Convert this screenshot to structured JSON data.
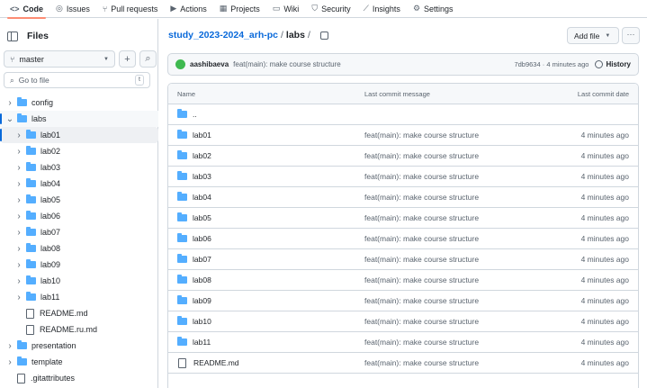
{
  "topnav": {
    "items": [
      {
        "icon": "<>",
        "label": "Code",
        "active": true
      },
      {
        "icon": "◎",
        "label": "Issues"
      },
      {
        "icon": "⑂",
        "label": "Pull requests"
      },
      {
        "icon": "▶",
        "label": "Actions"
      },
      {
        "icon": "▦",
        "label": "Projects"
      },
      {
        "icon": "▭",
        "label": "Wiki"
      },
      {
        "icon": "⛉",
        "label": "Security"
      },
      {
        "icon": "⟋",
        "label": "Insights"
      },
      {
        "icon": "⚙",
        "label": "Settings"
      }
    ]
  },
  "sidebar": {
    "title": "Files",
    "branch": "master",
    "add_label": "+",
    "search_label": "⌕",
    "goto_placeholder": "Go to file",
    "goto_shortcut": "t",
    "tree": [
      {
        "type": "dir",
        "name": "config",
        "depth": 0,
        "expanded": false
      },
      {
        "type": "dir",
        "name": "labs",
        "depth": 0,
        "expanded": true,
        "selected": true
      },
      {
        "type": "dir",
        "name": "lab01",
        "depth": 1,
        "expanded": false,
        "highlight": true
      },
      {
        "type": "dir",
        "name": "lab02",
        "depth": 1,
        "expanded": false
      },
      {
        "type": "dir",
        "name": "lab03",
        "depth": 1,
        "expanded": false
      },
      {
        "type": "dir",
        "name": "lab04",
        "depth": 1,
        "expanded": false
      },
      {
        "type": "dir",
        "name": "lab05",
        "depth": 1,
        "expanded": false
      },
      {
        "type": "dir",
        "name": "lab06",
        "depth": 1,
        "expanded": false
      },
      {
        "type": "dir",
        "name": "lab07",
        "depth": 1,
        "expanded": false
      },
      {
        "type": "dir",
        "name": "lab08",
        "depth": 1,
        "expanded": false
      },
      {
        "type": "dir",
        "name": "lab09",
        "depth": 1,
        "expanded": false
      },
      {
        "type": "dir",
        "name": "lab10",
        "depth": 1,
        "expanded": false
      },
      {
        "type": "dir",
        "name": "lab11",
        "depth": 1,
        "expanded": false
      },
      {
        "type": "file",
        "name": "README.md",
        "depth": 1
      },
      {
        "type": "file",
        "name": "README.ru.md",
        "depth": 1
      },
      {
        "type": "dir",
        "name": "presentation",
        "depth": 0,
        "expanded": false
      },
      {
        "type": "dir",
        "name": "template",
        "depth": 0,
        "expanded": false
      },
      {
        "type": "file",
        "name": ".gitattributes",
        "depth": 0
      }
    ]
  },
  "main": {
    "breadcrumb": {
      "repo": "study_2023-2024_arh-pc",
      "sep": "/",
      "current": "labs",
      "trail": "/"
    },
    "add_file_label": "Add file",
    "more_label": "···",
    "commit": {
      "author": "aashibaeva",
      "message": "feat(main): make course structure",
      "meta": "7db9634 · 4 minutes ago",
      "history_label": "History"
    },
    "table": {
      "headers": {
        "name": "Name",
        "message": "Last commit message",
        "date": "Last commit date"
      },
      "rows": [
        {
          "type": "dir",
          "name": "..",
          "message": "",
          "date": ""
        },
        {
          "type": "dir",
          "name": "lab01",
          "message": "feat(main): make course structure",
          "date": "4 minutes ago"
        },
        {
          "type": "dir",
          "name": "lab02",
          "message": "feat(main): make course structure",
          "date": "4 minutes ago"
        },
        {
          "type": "dir",
          "name": "lab03",
          "message": "feat(main): make course structure",
          "date": "4 minutes ago"
        },
        {
          "type": "dir",
          "name": "lab04",
          "message": "feat(main): make course structure",
          "date": "4 minutes ago"
        },
        {
          "type": "dir",
          "name": "lab05",
          "message": "feat(main): make course structure",
          "date": "4 minutes ago"
        },
        {
          "type": "dir",
          "name": "lab06",
          "message": "feat(main): make course structure",
          "date": "4 minutes ago"
        },
        {
          "type": "dir",
          "name": "lab07",
          "message": "feat(main): make course structure",
          "date": "4 minutes ago"
        },
        {
          "type": "dir",
          "name": "lab08",
          "message": "feat(main): make course structure",
          "date": "4 minutes ago"
        },
        {
          "type": "dir",
          "name": "lab09",
          "message": "feat(main): make course structure",
          "date": "4 minutes ago"
        },
        {
          "type": "dir",
          "name": "lab10",
          "message": "feat(main): make course structure",
          "date": "4 minutes ago"
        },
        {
          "type": "dir",
          "name": "lab11",
          "message": "feat(main): make course structure",
          "date": "4 minutes ago"
        },
        {
          "type": "file",
          "name": "README.md",
          "message": "feat(main): make course structure",
          "date": "4 minutes ago"
        }
      ]
    }
  },
  "colors": {
    "accent": "#0969da",
    "folder": "#54aeff",
    "tab_underline": "#fd8c73",
    "border": "#d0d7de"
  }
}
